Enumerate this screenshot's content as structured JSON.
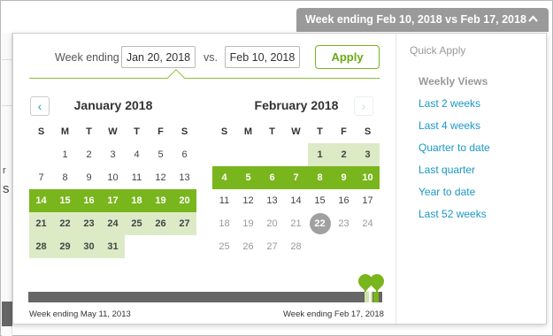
{
  "header": {
    "range_label": "Week ending Feb 10, 2018 vs Feb 17, 2018",
    "chevron": "chevron-up-icon"
  },
  "background": {
    "glyph_r": "r",
    "glyph_s": "s"
  },
  "compare": {
    "label": "Week ending",
    "primary_value": "Jan 20, 2018",
    "vs_label": "vs.",
    "secondary_value": "Feb 10, 2018",
    "apply_label": "Apply"
  },
  "calendars": {
    "weekdays": [
      "S",
      "M",
      "T",
      "W",
      "T",
      "F",
      "S"
    ],
    "left": {
      "title": "January 2018",
      "prev_icon": "‹"
    },
    "right": {
      "title": "February 2018",
      "next_icon": "›"
    }
  },
  "timeline": {
    "start_label": "Week ending May 11, 2013",
    "end_label": "Week ending Feb 17, 2018"
  },
  "quick_apply": {
    "heading": "Quick Apply",
    "section": "Weekly Views",
    "items": [
      "Last 2 weeks",
      "Last 4 weeks",
      "Quarter to date",
      "Last quarter",
      "Year to date",
      "Last 52 weeks"
    ]
  },
  "colors": {
    "accent_green": "#79b51c",
    "light_green": "#dcebc6",
    "link_blue": "#1a98c5",
    "header_gray": "#9a9a9a"
  }
}
